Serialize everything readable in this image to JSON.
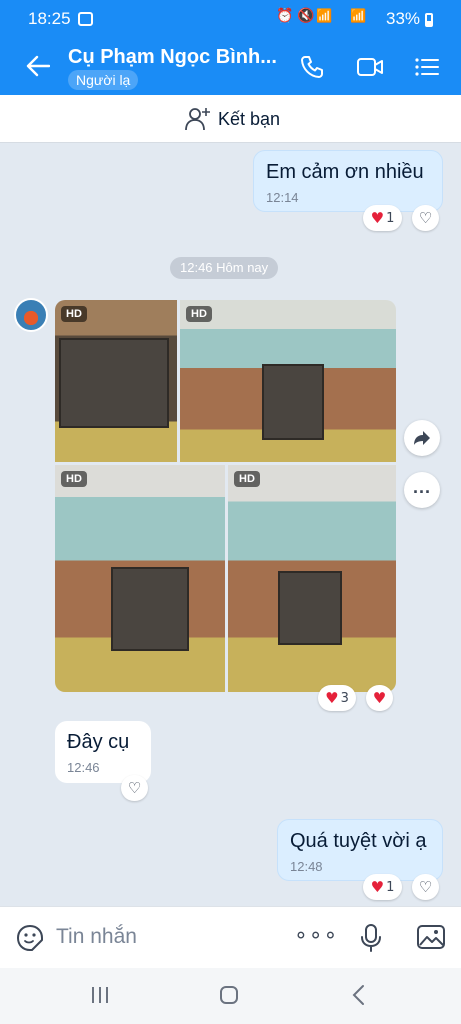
{
  "status": {
    "time": "18:25",
    "battery": "33%"
  },
  "header": {
    "title": "Cụ Phạm Ngọc Bình...",
    "subtitle": "Người lạ"
  },
  "friend_bar": {
    "label": "Kết bạn"
  },
  "messages": [
    {
      "text": "Em cảm ơn nhiều",
      "time": "12:14",
      "reaction_count": "1"
    },
    {
      "divider": "12:46 Hôm nay"
    },
    {
      "images": [
        "HD",
        "HD",
        "HD",
        "HD"
      ],
      "reaction_count": "3"
    },
    {
      "text": "Đây cụ",
      "time": "12:46"
    },
    {
      "text": "Quá tuyệt vời ạ",
      "time": "12:48",
      "reaction_count": "1"
    }
  ],
  "input": {
    "placeholder": "Tin nhắn"
  },
  "colors": {
    "brand": "#1a8cf6",
    "bubble_me": "#dbeeff",
    "heart": "#e5213a",
    "background": "#e2e9f1"
  }
}
